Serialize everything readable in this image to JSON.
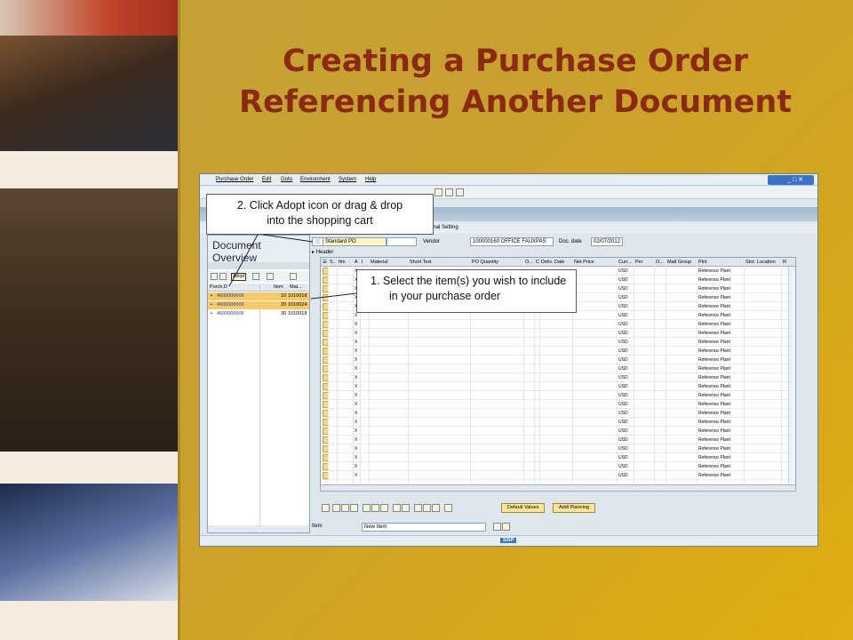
{
  "slide": {
    "title_line1": "Creating a Purchase Order",
    "title_line2": "Referencing Another Document"
  },
  "sap": {
    "menu": [
      "Purchase Order",
      "Edit",
      "Goto",
      "Environment",
      "System",
      "Help"
    ],
    "personal_setting": "rsonal Setting",
    "doc_overview_title": "Document Overview",
    "adopt_tooltip": "Adopt",
    "doc_table": {
      "col_purch": "Purch.D",
      "col_item": "Item",
      "col_mat": "Mat...",
      "rows": [
        {
          "doc": "4600000006",
          "item": "10",
          "mat": "1010018"
        },
        {
          "doc": "4600000006",
          "item": "20",
          "mat": "1010024"
        },
        {
          "doc": "4600000006",
          "item": "30",
          "mat": "1010018"
        }
      ]
    },
    "header": {
      "po_type": "Standard PO",
      "vendor_label": "Vendor",
      "vendor_value": "100000160 OFFICE FAUXPAS",
      "doc_date_label": "Doc. date",
      "doc_date_value": "02/07/2012",
      "header_toggle": "Header"
    },
    "grid": {
      "columns": [
        "S..",
        "Itm",
        "A",
        "I",
        "Material",
        "Short Text",
        "PO Quantity",
        "O...",
        "C",
        "Deliv. Date",
        "Net Price",
        "Curr...",
        "Per",
        "O...",
        "Matl Group",
        "Plnt",
        "Stor. Location",
        "R"
      ],
      "row_x": "X",
      "row_curr": "USD",
      "row_plant": "Reference Plant",
      "row_count": 24
    },
    "buttons": {
      "default_values": "Default Values",
      "addl_planning": "Addl Planning"
    },
    "item_bar": {
      "label": "Item",
      "value": "New Item"
    },
    "status_logo": "SAP"
  },
  "callouts": {
    "adopt_line1": "2. Click Adopt icon or drag & drop",
    "adopt_line2": "into the shopping cart",
    "select_line": "1.   Select the item(s) you wish to include in your purchase order"
  },
  "colors": {
    "title": "#8b2a12",
    "slide_bg": "#d3a61f",
    "selected_row": "#f6c96a"
  }
}
